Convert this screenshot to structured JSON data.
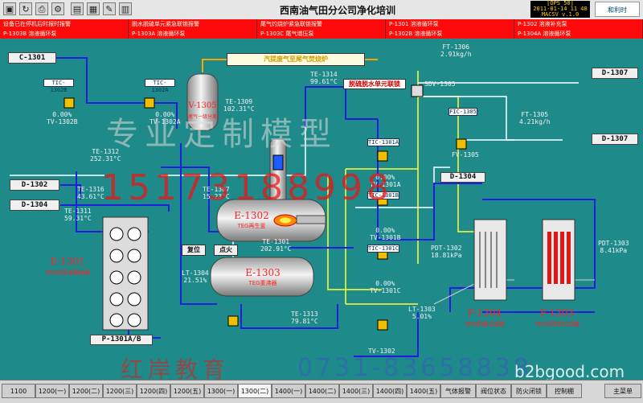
{
  "toolbar": {
    "title": "西南油气田分公司净化培训",
    "icons": [
      "display-icon",
      "refresh-icon",
      "print-icon",
      "tools-icon",
      "folder-icon",
      "document-icon",
      "settings-icon",
      "book-icon"
    ],
    "clock_lines": [
      "[OPS 50]",
      "2011-01-14 11 48",
      "MACSV v.1.0"
    ],
    "logo": "和利时"
  },
  "alarms": [
    {
      "text": "设备已在停机后时报时报警"
    },
    {
      "text": "脱水脱硫单元紧急联锁报警"
    },
    {
      "text": "尾气灼烧炉紧急联锁报警"
    },
    {
      "text": "P-1301 溶液循环泵"
    },
    {
      "text": "P-1302 溶液补充泵"
    },
    {
      "text": "P-1303B 溶液循环泵"
    },
    {
      "text": "P-1303A 溶液循环泵"
    },
    {
      "text": "P-1303C 尾气增压泵"
    },
    {
      "text": "P-1302B 溶液循环泵"
    },
    {
      "text": "P-1304A 溶液循环泵"
    }
  ],
  "diagram": {
    "streams": [
      {
        "label": "C-1301"
      },
      {
        "label": "D-1302"
      },
      {
        "label": "D-1304"
      },
      {
        "label": "D-1307"
      },
      {
        "label": "D-1307"
      },
      {
        "label": "D-1304"
      },
      {
        "label": "P-1301A/B"
      }
    ],
    "banner_exhaust": "汽提废气至尾气焚烧炉",
    "banner_interlock": "脱硫脱水单元联锁",
    "controllers": [
      "TIC-1302B",
      "TIC-1302A",
      "TIC-1301A",
      "TIC-1301B",
      "TIC-1301C",
      "FIC-1305"
    ],
    "tags": [
      {
        "name": "TV-1302B",
        "value": "0.00%"
      },
      {
        "name": "TV-1302A",
        "value": "0.00%"
      },
      {
        "name": "TE-1312",
        "value": "252.31°C"
      },
      {
        "name": "TE-1316",
        "value": "43.61°C"
      },
      {
        "name": "TE-1311",
        "value": "59.31°C"
      },
      {
        "name": "TE-1314",
        "value": "99.61°C"
      },
      {
        "name": "TE-1309",
        "value": "102.31°C"
      },
      {
        "name": "TE-1307",
        "value": "15.23°C"
      },
      {
        "name": "TE-1301",
        "value": "202.91°C"
      },
      {
        "name": "LT-1304",
        "value": "21.51%"
      },
      {
        "name": "TE-1313",
        "value": "79.81°C"
      },
      {
        "name": "TV-1301A",
        "value": "0.00%"
      },
      {
        "name": "TV-1301B",
        "value": "0.00%"
      },
      {
        "name": "TV-1301C",
        "value": "0.00%"
      },
      {
        "name": "FT-1306",
        "value": "2.91kg/h"
      },
      {
        "name": "FT-1305",
        "value": "4.21kg/h"
      },
      {
        "name": "FV-1305",
        "value": ""
      },
      {
        "name": "PDT-1302",
        "value": "18.81kPa"
      },
      {
        "name": "PDT-1303",
        "value": "8.41kPa"
      },
      {
        "name": "LT-1303",
        "value": "5.01%"
      },
      {
        "name": "TV-1302",
        "value": ""
      },
      {
        "name": "SDV-1305",
        "value": ""
      }
    ],
    "equipment": [
      {
        "id": "E-1302",
        "desc": "TEG再生釜"
      },
      {
        "id": "E-1303",
        "desc": "TEG重沸器"
      },
      {
        "id": "E-1301",
        "desc": "TEG贫富液换热器"
      },
      {
        "id": "F-1304",
        "desc": "TEG机械过滤器"
      },
      {
        "id": "F-1303",
        "desc": "TEG活性炭过滤器"
      },
      {
        "id": "V-1305",
        "desc": "尾气一级分离"
      }
    ],
    "buttons": [
      "复位",
      "点火"
    ],
    "watermarks": [
      "专业定制模型",
      "15173188998",
      "红岸教育",
      "0731-83658838",
      "b2bgood.com"
    ]
  },
  "nav": [
    "1100",
    "1200(一)",
    "1200(二)",
    "1200(三)",
    "1200(四)",
    "1200(五)",
    "1300(一)",
    "1300(二)",
    "1400(一)",
    "1400(二)",
    "1400(三)",
    "1400(四)",
    "1400(五)",
    "气体报警",
    "阀位状态",
    "防火闭锁",
    "控制棚",
    "主菜单"
  ],
  "nav_active": 7
}
